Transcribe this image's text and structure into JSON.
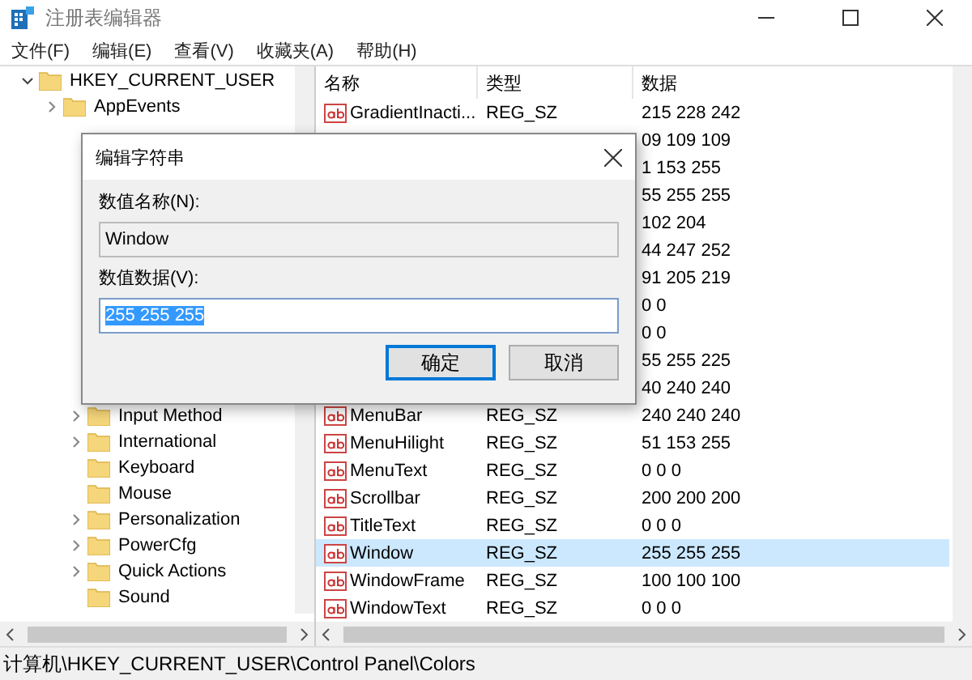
{
  "window": {
    "title": "注册表编辑器"
  },
  "menu": [
    "文件(F)",
    "编辑(E)",
    "查看(V)",
    "收藏夹(A)",
    "帮助(H)"
  ],
  "tree": [
    {
      "label": "HKEY_CURRENT_USER",
      "kind": "expanded",
      "children": [
        {
          "label": "AppEvents",
          "kind": "collapsed"
        }
      ]
    }
  ],
  "tree_lower": [
    {
      "label": "Input Method",
      "kind": "collapsed"
    },
    {
      "label": "International",
      "kind": "collapsed"
    },
    {
      "label": "Keyboard",
      "kind": "leaf"
    },
    {
      "label": "Mouse",
      "kind": "leaf"
    },
    {
      "label": "Personalization",
      "kind": "collapsed"
    },
    {
      "label": "PowerCfg",
      "kind": "collapsed"
    },
    {
      "label": "Quick Actions",
      "kind": "collapsed"
    },
    {
      "label": "Sound",
      "kind": "leaf"
    }
  ],
  "list": {
    "columns": [
      "名称",
      "类型",
      "数据"
    ],
    "rows": [
      {
        "name": "GradientInacti...",
        "type": "REG_SZ",
        "data": "215 228 242",
        "selected": false
      },
      {
        "data": "09 109 109",
        "selected": false
      },
      {
        "data": "1 153 255",
        "selected": false
      },
      {
        "data": "55 255 255",
        "selected": false
      },
      {
        "data": "102 204",
        "selected": false
      },
      {
        "data": "44 247 252",
        "selected": false
      },
      {
        "data": "91 205 219",
        "selected": false
      },
      {
        "data": "0 0",
        "selected": false
      },
      {
        "data": "0 0",
        "selected": false
      },
      {
        "data": "55 255 225",
        "selected": false
      },
      {
        "data": "40 240 240",
        "selected": false
      },
      {
        "name": "MenuBar",
        "type": "REG_SZ",
        "data": "240 240 240",
        "selected": false
      },
      {
        "name": "MenuHilight",
        "type": "REG_SZ",
        "data": "51 153 255",
        "selected": false
      },
      {
        "name": "MenuText",
        "type": "REG_SZ",
        "data": "0 0 0",
        "selected": false
      },
      {
        "name": "Scrollbar",
        "type": "REG_SZ",
        "data": "200 200 200",
        "selected": false
      },
      {
        "name": "TitleText",
        "type": "REG_SZ",
        "data": "0 0 0",
        "selected": false
      },
      {
        "name": "Window",
        "type": "REG_SZ",
        "data": "255 255 255",
        "selected": true
      },
      {
        "name": "WindowFrame",
        "type": "REG_SZ",
        "data": "100 100 100",
        "selected": false
      },
      {
        "name": "WindowText",
        "type": "REG_SZ",
        "data": "0 0 0",
        "selected": false
      }
    ]
  },
  "dialog": {
    "title": "编辑字符串",
    "name_label": "数值名称(N):",
    "name_value": "Window",
    "data_label": "数值数据(V):",
    "data_value": "255 255 255",
    "buttons": [
      {
        "label": "确定",
        "default": true
      },
      {
        "label": "取消",
        "default": false
      }
    ]
  },
  "status_bar": "计算机\\HKEY_CURRENT_USER\\Control Panel\\Colors"
}
